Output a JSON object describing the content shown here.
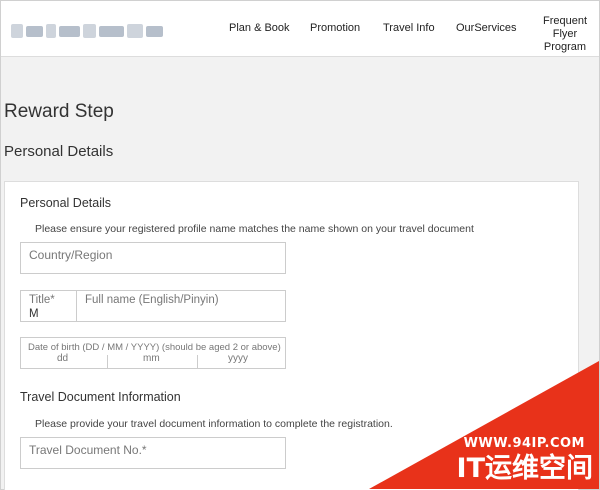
{
  "header": {
    "logo_icon": "blurred-airline-logo",
    "nav": [
      "Plan & Book",
      "Promotion",
      "Travel Info",
      "OurServices",
      "Frequent Flyer Program"
    ]
  },
  "page": {
    "title": "Reward Step",
    "section": "Personal Details"
  },
  "personal": {
    "heading": "Personal Details",
    "note": "Please ensure your registered profile name matches the name shown on your travel document",
    "country_placeholder": "Country/Region",
    "title_label": "Title*",
    "title_value": "M",
    "fullname_placeholder": "Full name (English/Pinyin)",
    "dob_label": "Date of birth (DD / MM / YYYY) (should be aged 2 or above)",
    "dob_dd": "dd",
    "dob_mm": "mm",
    "dob_yyyy": "yyyy"
  },
  "travel_doc": {
    "heading": "Travel Document Information",
    "note": "Please provide your travel document information to complete the registration.",
    "doc_no_placeholder": "Travel Document No.*"
  },
  "watermark": {
    "url": "WWW.94IP.COM",
    "brand": "IT运维空间",
    "color": "#e8321a"
  }
}
